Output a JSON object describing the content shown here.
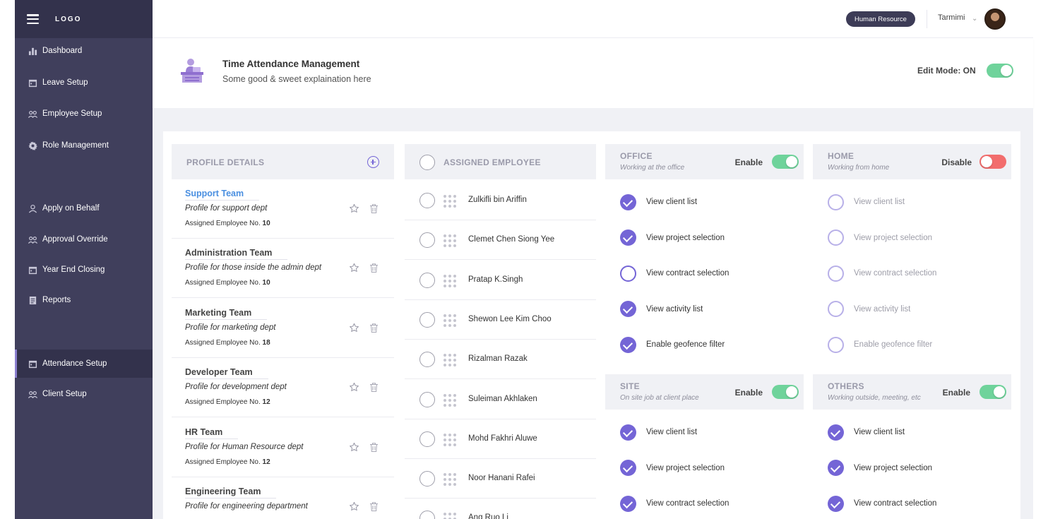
{
  "sidebar": {
    "logo": "LOGO",
    "items": [
      {
        "label": "Dashboard",
        "icon": "bar-chart-icon"
      },
      {
        "label": "Leave Setup",
        "icon": "calendar-icon"
      },
      {
        "label": "Employee Setup",
        "icon": "users-icon"
      },
      {
        "label": "Role Management",
        "icon": "gear-icon"
      },
      {
        "label": "Apply on Behalf",
        "icon": "user-icon"
      },
      {
        "label": "Approval Override",
        "icon": "users-icon"
      },
      {
        "label": "Year End Closing",
        "icon": "calendar-icon"
      },
      {
        "label": "Reports",
        "icon": "document-icon"
      },
      {
        "label": "Attendance Setup",
        "icon": "calendar-icon",
        "active": true
      },
      {
        "label": "Client Setup",
        "icon": "users-icon"
      }
    ]
  },
  "topbar": {
    "role": "Human Resource",
    "user_name": "Tarmimi"
  },
  "header": {
    "title": "Time Attendance Management",
    "subtitle": "Some good & sweet explaination here",
    "edit_mode_label": "Edit Mode: ON",
    "edit_mode_on": true
  },
  "profiles": {
    "header": "PROFILE DETAILS",
    "count_label": "Assigned Employee No.",
    "items": [
      {
        "name": "Support Team",
        "desc": "Profile for support dept",
        "count": "10",
        "selected": true
      },
      {
        "name": "Administration Team",
        "desc": "Profile for those inside the admin dept",
        "count": "10"
      },
      {
        "name": "Marketing Team",
        "desc": "Profile for marketing dept",
        "count": "18"
      },
      {
        "name": "Developer Team",
        "desc": "Profile for development dept",
        "count": "12"
      },
      {
        "name": "HR Team",
        "desc": "Profile for Human Resource dept",
        "count": "12"
      },
      {
        "name": "Engineering Team",
        "desc": "Profile for engineering department",
        "count": ""
      }
    ]
  },
  "employees": {
    "header": "ASSIGNED EMPLOYEE",
    "items": [
      "Zulkifli bin Ariffin",
      "Clemet Chen Siong Yee",
      "Pratap K.Singh",
      "Shewon Lee Kim Choo",
      "Rizalman Razak",
      "Suleiman Akhlaken",
      "Mohd Fakhri Aluwe",
      "Noor Hanani Rafei",
      "Ang Ruo Li"
    ]
  },
  "locations": {
    "office": {
      "title": "OFFICE",
      "subtitle": "Working at the office",
      "state": "Enable",
      "enabled": true,
      "perms": [
        {
          "label": "View client list",
          "checked": true
        },
        {
          "label": "View project selection",
          "checked": true
        },
        {
          "label": "View contract selection",
          "checked": false
        },
        {
          "label": "View activity list",
          "checked": true
        },
        {
          "label": "Enable geofence filter",
          "checked": true
        }
      ]
    },
    "home": {
      "title": "HOME",
      "subtitle": "Working from home",
      "state": "Disable",
      "enabled": false,
      "perms": [
        {
          "label": "View client list",
          "checked": false
        },
        {
          "label": "View project selection",
          "checked": false
        },
        {
          "label": "View contract selection",
          "checked": false
        },
        {
          "label": "View activity list",
          "checked": false
        },
        {
          "label": "Enable geofence filter",
          "checked": false
        }
      ]
    },
    "site": {
      "title": "SITE",
      "subtitle": "On site job at client place",
      "state": "Enable",
      "enabled": true,
      "perms": [
        {
          "label": "View client list",
          "checked": true
        },
        {
          "label": "View project selection",
          "checked": true
        },
        {
          "label": "View contract selection",
          "checked": true
        }
      ]
    },
    "others": {
      "title": "OTHERS",
      "subtitle": "Working outside, meeting, etc",
      "state": "Enable",
      "enabled": true,
      "perms": [
        {
          "label": "View client list",
          "checked": true
        },
        {
          "label": "View project selection",
          "checked": true
        },
        {
          "label": "View contract selection",
          "checked": true
        }
      ]
    }
  },
  "colors": {
    "sidebar": "#403f5c",
    "accent": "#7465d6",
    "toggle_on": "#6fd39b",
    "toggle_off": "#f26d6d",
    "link": "#4a8fe0"
  }
}
